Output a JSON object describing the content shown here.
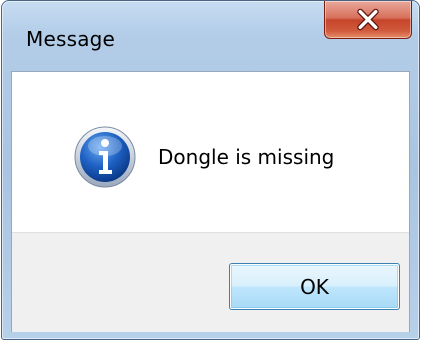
{
  "window": {
    "title": "Message"
  },
  "message": {
    "text": "Dongle is missing",
    "icon": "info-icon"
  },
  "buttons": {
    "ok_label": "OK",
    "close_icon": "close-icon"
  },
  "colors": {
    "close_button": "#c6442a",
    "ok_button_border": "#3c7fb1",
    "info_icon": "#1a5fb4",
    "button_area": "#f0f0f0"
  }
}
